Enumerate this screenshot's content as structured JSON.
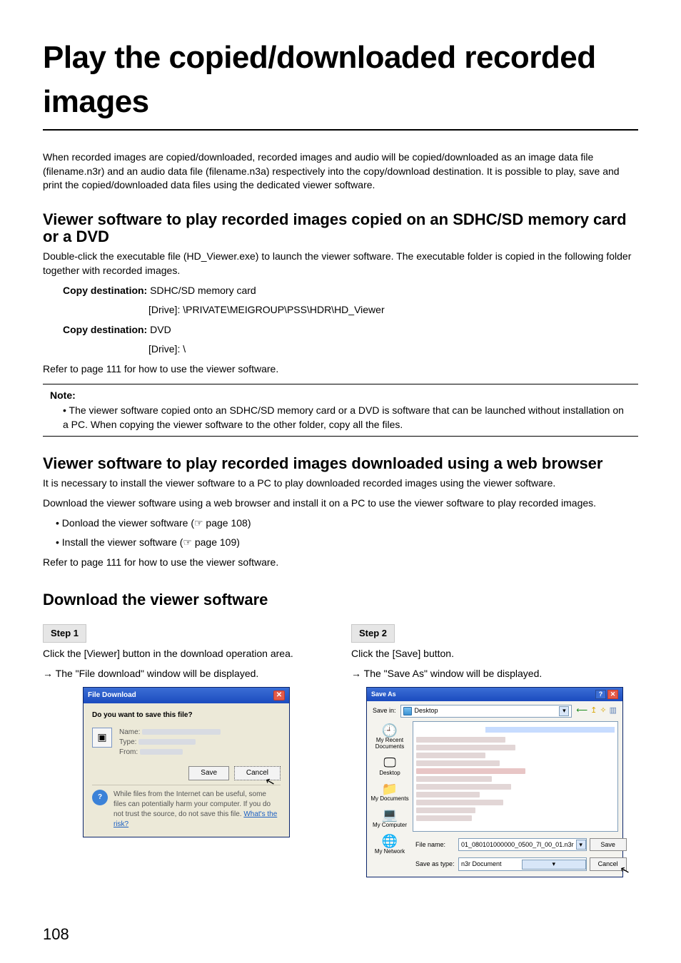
{
  "title": "Play the copied/downloaded recorded images",
  "intro": "When recorded images are copied/downloaded, recorded images and audio will be copied/downloaded as an image data file (filename.n3r) and an audio data file (filename.n3a) respectively into the copy/download destination. It is possible to play, save and print the copied/downloaded data files using the dedicated viewer software.",
  "sec1": {
    "heading": "Viewer software to play recorded images copied on an SDHC/SD memory card or a DVD",
    "p1": "Double-click the executable file (HD_Viewer.exe) to launch the viewer software. The executable folder is copied in the following folder together with recorded images.",
    "cd1_label": "Copy destination: ",
    "cd1_value": "SDHC/SD memory card",
    "cd1_path": "[Drive]: \\PRIVATE\\MEIGROUP\\PSS\\HDR\\HD_Viewer",
    "cd2_label": "Copy destination: ",
    "cd2_value": "DVD",
    "cd2_path": "[Drive]: \\",
    "ref": "Refer to page 111 for how to use the viewer software."
  },
  "note": {
    "label": "Note:",
    "text": "• The viewer software copied onto an SDHC/SD memory card or a DVD is software that can be launched without installation on a PC. When copying the viewer software to the other folder, copy all the files."
  },
  "sec2": {
    "heading": "Viewer software to play recorded images downloaded using a web browser",
    "p1": "It is necessary to install the viewer software to a PC to play downloaded recorded images using the viewer software.",
    "p2": "Download the viewer software using a web browser and install it on a PC to use the viewer software to play recorded images.",
    "b1": "• Donload the viewer software (☞ page 108)",
    "b2": "• Install the viewer software (☞ page 109)",
    "ref": "Refer to page 111 for how to use the viewer software."
  },
  "sec3": {
    "heading": "Download the viewer software",
    "step1_label": "Step 1",
    "step1_text": "Click the [Viewer] button in the download operation area.",
    "step1_arrow": "The \"File download\" window will be displayed.",
    "step2_label": "Step 2",
    "step2_text": "Click the [Save] button.",
    "step2_arrow": "The \"Save As\" window will be displayed."
  },
  "dlg_download": {
    "title": "File Download",
    "question": "Do you want to save this file?",
    "name": "Name:",
    "type": "Type:",
    "from": "From:",
    "save": "Save",
    "cancel": "Cancel",
    "warn": "While files from the Internet can be useful, some files can potentially harm your computer. If you do not trust the source, do not save this file. ",
    "risk": "What's the risk?",
    "file_icon": "▣"
  },
  "dlg_saveas": {
    "title": "Save As",
    "savein": "Save in:",
    "savein_value": "Desktop",
    "places": {
      "recent": "My Recent Documents",
      "desktop": "Desktop",
      "mydocs": "My Documents",
      "mycomp": "My Computer",
      "mynet": "My Network"
    },
    "filename_label": "File name:",
    "filename_value": "01_080101000000_0500_7l_00_01.n3r",
    "savetype_label": "Save as type:",
    "savetype_value": "n3r Document",
    "save": "Save",
    "cancel": "Cancel",
    "tool_back": "⟵",
    "tool_up": "↥",
    "tool_new": "✧",
    "tool_menu": "▥"
  },
  "page_number": "108"
}
